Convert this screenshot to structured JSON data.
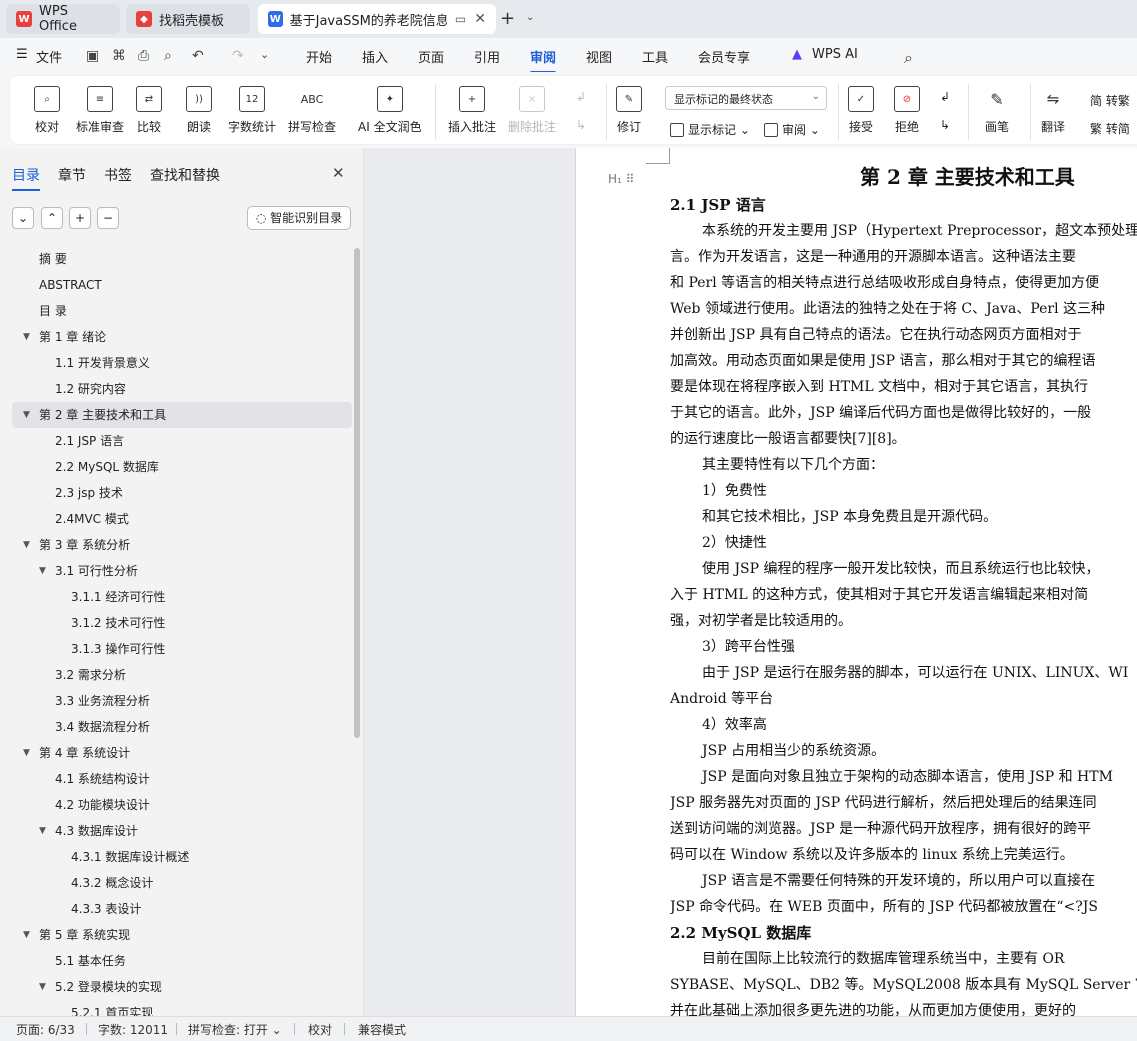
{
  "tabs": [
    {
      "label": "WPS Office",
      "active": false,
      "logo_color": "#e8403c"
    },
    {
      "label": "找稻壳模板",
      "active": false,
      "logo_color": "#e8403c"
    },
    {
      "label": "基于JavaSSM的养老院信息管",
      "active": true,
      "logo_color": "#2b6ee8"
    }
  ],
  "new_tab_symbol": "+",
  "menu": {
    "file": "文件",
    "items": [
      "开始",
      "插入",
      "页面",
      "引用",
      "审阅",
      "视图",
      "工具",
      "会员专享"
    ],
    "active": "审阅",
    "ai": "WPS AI"
  },
  "ribbon": {
    "proofread": "校对",
    "standard_review": "标准审查",
    "compare": "比较",
    "read_aloud": "朗读",
    "word_count": "字数统计",
    "spell_check": "拼写检查",
    "ai_polish": "AI 全文润色",
    "insert_comment": "插入批注",
    "delete_comment": "删除批注",
    "track_changes": "修订",
    "markup_select": "显示标记的最终状态",
    "show_markup": "显示标记",
    "review_pane": "审阅",
    "accept": "接受",
    "reject": "拒绝",
    "pen": "画笔",
    "translate": "翻译",
    "to_traditional": "简 转繁",
    "to_simplified": "繁 转简",
    "word_count_icon_text": "12",
    "spell_icon_text": "ABC"
  },
  "nav": {
    "tabs": [
      "目录",
      "章节",
      "书签",
      "查找和替换"
    ],
    "active_tab": "目录",
    "smart_button": "智能识别目录",
    "toc": [
      {
        "label": "摘 要",
        "level": 0,
        "expand": "none"
      },
      {
        "label": "ABSTRACT",
        "level": 0,
        "expand": "none"
      },
      {
        "label": "目 录",
        "level": 0,
        "expand": "none"
      },
      {
        "label": "第 1 章 绪论",
        "level": 0,
        "expand": "open"
      },
      {
        "label": "1.1 开发背景意义",
        "level": 1,
        "expand": "none"
      },
      {
        "label": "1.2 研究内容",
        "level": 1,
        "expand": "none"
      },
      {
        "label": "第 2 章 主要技术和工具",
        "level": 0,
        "expand": "open",
        "selected": true
      },
      {
        "label": "2.1 JSP 语言",
        "level": 1,
        "expand": "none"
      },
      {
        "label": "2.2 MySQL 数据库",
        "level": 1,
        "expand": "none"
      },
      {
        "label": "2.3 jsp 技术",
        "level": 1,
        "expand": "none"
      },
      {
        "label": "2.4MVC 模式",
        "level": 1,
        "expand": "none"
      },
      {
        "label": "第 3 章 系统分析",
        "level": 0,
        "expand": "open"
      },
      {
        "label": "3.1 可行性分析",
        "level": 1,
        "expand": "open"
      },
      {
        "label": "3.1.1 经济可行性",
        "level": 2,
        "expand": "none"
      },
      {
        "label": "3.1.2 技术可行性",
        "level": 2,
        "expand": "none"
      },
      {
        "label": "3.1.3 操作可行性",
        "level": 2,
        "expand": "none"
      },
      {
        "label": "3.2 需求分析",
        "level": 1,
        "expand": "none"
      },
      {
        "label": "3.3 业务流程分析",
        "level": 1,
        "expand": "none"
      },
      {
        "label": "3.4 数据流程分析",
        "level": 1,
        "expand": "none"
      },
      {
        "label": "第 4 章 系统设计",
        "level": 0,
        "expand": "open"
      },
      {
        "label": "4.1 系统结构设计",
        "level": 1,
        "expand": "none"
      },
      {
        "label": "4.2 功能模块设计",
        "level": 1,
        "expand": "none"
      },
      {
        "label": "4.3 数据库设计",
        "level": 1,
        "expand": "open"
      },
      {
        "label": "4.3.1 数据库设计概述",
        "level": 2,
        "expand": "none"
      },
      {
        "label": "4.3.2 概念设计",
        "level": 2,
        "expand": "none"
      },
      {
        "label": "4.3.3 表设计",
        "level": 2,
        "expand": "none"
      },
      {
        "label": "第 5 章  系统实现",
        "level": 0,
        "expand": "open"
      },
      {
        "label": "5.1 基本任务",
        "level": 1,
        "expand": "none"
      },
      {
        "label": "5.2 登录模块的实现",
        "level": 1,
        "expand": "open"
      },
      {
        "label": "5.2.1 首页实现",
        "level": 2,
        "expand": "none"
      }
    ]
  },
  "document": {
    "lines": [
      {
        "text": "第 2 章  主要技术和工具",
        "style": "h1"
      },
      {
        "text": "2.1  JSP 语言",
        "style": "h2"
      },
      {
        "text": "本系统的开发主要用 JSP（Hypertext Preprocessor，超文本预处理",
        "style": "indent"
      },
      {
        "text": "言。作为开发语言，这是一种通用的开源脚本语言。这种语法主要",
        "style": "body"
      },
      {
        "text": "和 Perl 等语言的相关特点进行总结吸收形成自身特点，使得更加方便",
        "style": "body"
      },
      {
        "text": "Web 领域进行使用。此语法的独特之处在于将 C、Java、Perl 这三种",
        "style": "body"
      },
      {
        "text": "并创新出 JSP 具有自己特点的语法。它在执行动态网页方面相对于",
        "style": "body"
      },
      {
        "text": "加高效。用动态页面如果是使用 JSP 语言，那么相对于其它的编程语",
        "style": "body"
      },
      {
        "text": "要是体现在将程序嵌入到 HTML 文档中，相对于其它语言，其执行",
        "style": "body"
      },
      {
        "text": "于其它的语言。此外，JSP 编译后代码方面也是做得比较好的，一般",
        "style": "body"
      },
      {
        "text": "的运行速度比一般语言都要快[7][8]。",
        "style": "body"
      },
      {
        "text": "其主要特性有以下几个方面：",
        "style": "indent"
      },
      {
        "text": "1）免费性",
        "style": "indent"
      },
      {
        "text": "和其它技术相比，JSP 本身免费且是开源代码。",
        "style": "indent"
      },
      {
        "text": "2）快捷性",
        "style": "indent"
      },
      {
        "text": "使用 JSP 编程的程序一般开发比较快，而且系统运行也比较快，",
        "style": "indent"
      },
      {
        "text": "入于 HTML 的这种方式，使其相对于其它开发语言编辑起来相对简",
        "style": "body"
      },
      {
        "text": "强，对初学者是比较适用的。",
        "style": "body"
      },
      {
        "text": "3）跨平台性强",
        "style": "indent"
      },
      {
        "text": "由于 JSP 是运行在服务器的脚本，可以运行在 UNIX、LINUX、WI",
        "style": "indent"
      },
      {
        "text": "Android 等平台",
        "style": "body"
      },
      {
        "text": "4）效率高",
        "style": "indent"
      },
      {
        "text": "JSP 占用相当少的系统资源。",
        "style": "indent"
      },
      {
        "text": "JSP 是面向对象且独立于架构的动态脚本语言，使用 JSP 和 HTM",
        "style": "indent"
      },
      {
        "text": "JSP 服务器先对页面的 JSP 代码进行解析，然后把处理后的结果连同",
        "style": "body"
      },
      {
        "text": "送到访问端的浏览器。JSP 是一种源代码开放程序，拥有很好的跨平",
        "style": "body"
      },
      {
        "text": "码可以在 Window 系统以及许多版本的 linux 系统上完美运行。",
        "style": "body"
      },
      {
        "text": "JSP 语言是不需要任何特殊的开发环境的，所以用户可以直接在",
        "style": "indent"
      },
      {
        "text": "JSP 命令代码。在 WEB 页面中，所有的 JSP 代码都被放置在“<?JS",
        "style": "body"
      },
      {
        "text": "2.2  MySQL 数据库",
        "style": "h2"
      },
      {
        "text": "目前在国际上比较流行的数据库管理系统当中，主要有 OR",
        "style": "indent"
      },
      {
        "text": "SYBASE、MySQL、DB2 等。MySQL2008 版本具有 MySQL Server 7",
        "style": "body"
      },
      {
        "text": "并在此基础上添加很多更先进的功能，从而更加方便使用，更好的",
        "style": "body"
      }
    ]
  },
  "status": {
    "page": "页面: 6/33",
    "words": "字数: 12011",
    "spell": "拼写检查: 打开",
    "proof": "校对",
    "compat": "兼容模式"
  }
}
